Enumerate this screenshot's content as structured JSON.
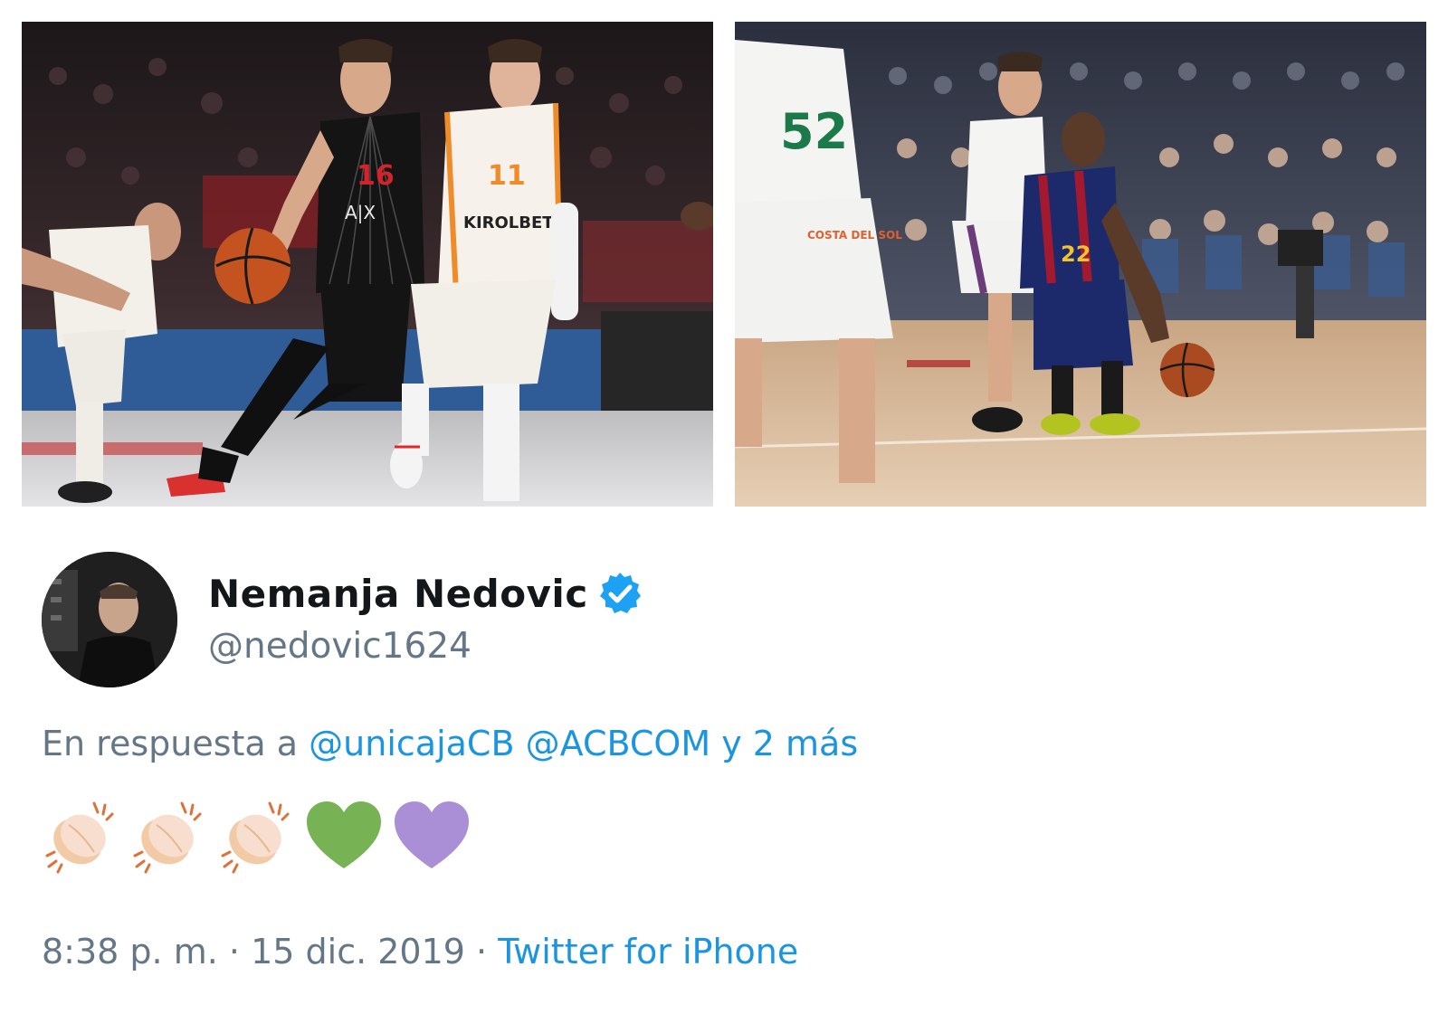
{
  "photos": [
    {
      "name": "Basketball game photo: player in black jersey dribbling past player in white and orange jersey",
      "jersey_numbers": [
        "16",
        "11"
      ],
      "jersey_text": [
        "A|X",
        "KIROLBET"
      ]
    },
    {
      "name": "Basketball game photo: player in blue and red jersey dribbling against defender in white and green jersey",
      "jersey_numbers": [
        "52",
        "22"
      ],
      "jersey_text": [
        "COSTA DEL SOL"
      ]
    }
  ],
  "tweet": {
    "author": {
      "display_name": "Nemanja Nedovic",
      "handle": "@nedovic1624",
      "verified": true
    },
    "reply": {
      "prefix": "En respuesta a",
      "mention_1": "@unicajaCB",
      "mention_2": "@ACBCOM",
      "suffix": "y 2 más"
    },
    "emojis": [
      "clapping-hands",
      "clapping-hands",
      "clapping-hands",
      "green-heart",
      "purple-heart"
    ],
    "time": "8:38 p. m.",
    "date": "15 dic. 2019",
    "separator": "·",
    "source": "Twitter for iPhone"
  },
  "colors": {
    "link": "#1b95e0",
    "secondary_text": "#657786",
    "primary_text": "#14171a",
    "verified": "#1da1f2",
    "green_heart": "#77b255",
    "purple_heart": "#aa8ed6",
    "clap": "#f7dece"
  }
}
